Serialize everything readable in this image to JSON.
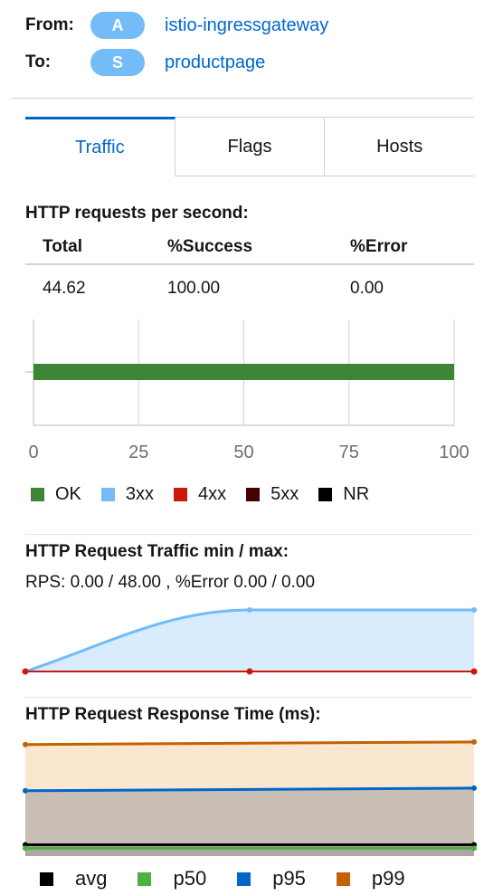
{
  "edge": {
    "from_label": "From:",
    "from_badge": "A",
    "from_name": "istio-ingressgateway",
    "to_label": "To:",
    "to_badge": "S",
    "to_name": "productpage"
  },
  "tabs": [
    {
      "label": "Traffic",
      "active": true
    },
    {
      "label": "Flags",
      "active": false
    },
    {
      "label": "Hosts",
      "active": false
    }
  ],
  "http_rps": {
    "title": "HTTP requests per second:",
    "headers": [
      "Total",
      "%Success",
      "%Error"
    ],
    "values": [
      "44.62",
      "100.00",
      "0.00"
    ]
  },
  "traffic_title": "HTTP Request Traffic min / max:",
  "traffic_summary": "RPS: 0.00 / 48.00 , %Error 0.00 / 0.00",
  "response_title": "HTTP Request Response Time (ms):",
  "colors": {
    "ok": "#3e8635",
    "3xx": "#73bcf7",
    "4xx": "#c9190b",
    "5xx": "#470000",
    "nr": "#000000",
    "avg": "#000000",
    "p50": "#4cb140",
    "p95": "#0066cc",
    "p99": "#c46100"
  },
  "chart_data": [
    {
      "type": "bar",
      "orientation": "horizontal",
      "categories": [
        ""
      ],
      "series": [
        {
          "name": "OK",
          "values": [
            100
          ]
        },
        {
          "name": "3xx",
          "values": [
            0
          ]
        },
        {
          "name": "4xx",
          "values": [
            0
          ]
        },
        {
          "name": "5xx",
          "values": [
            0
          ]
        },
        {
          "name": "NR",
          "values": [
            0
          ]
        }
      ],
      "x_ticks": [
        "0",
        "25",
        "50",
        "75",
        "100"
      ],
      "xlim": [
        0,
        100
      ],
      "grid": true,
      "legend": "bottom"
    },
    {
      "type": "area",
      "x": [
        0,
        1,
        2
      ],
      "series": [
        {
          "name": "RPS",
          "values": [
            0,
            48,
            48
          ]
        },
        {
          "name": "%Error",
          "values": [
            0,
            0,
            0
          ]
        }
      ],
      "ylim": [
        0,
        48
      ]
    },
    {
      "type": "area",
      "x": [
        0,
        1
      ],
      "series": [
        {
          "name": "avg",
          "values": [
            13,
            13
          ]
        },
        {
          "name": "p50",
          "values": [
            9,
            9
          ]
        },
        {
          "name": "p95",
          "values": [
            75,
            78
          ]
        },
        {
          "name": "p99",
          "values": [
            128,
            131
          ]
        }
      ],
      "ylim": [
        0,
        135
      ],
      "legend": "bottom"
    }
  ]
}
